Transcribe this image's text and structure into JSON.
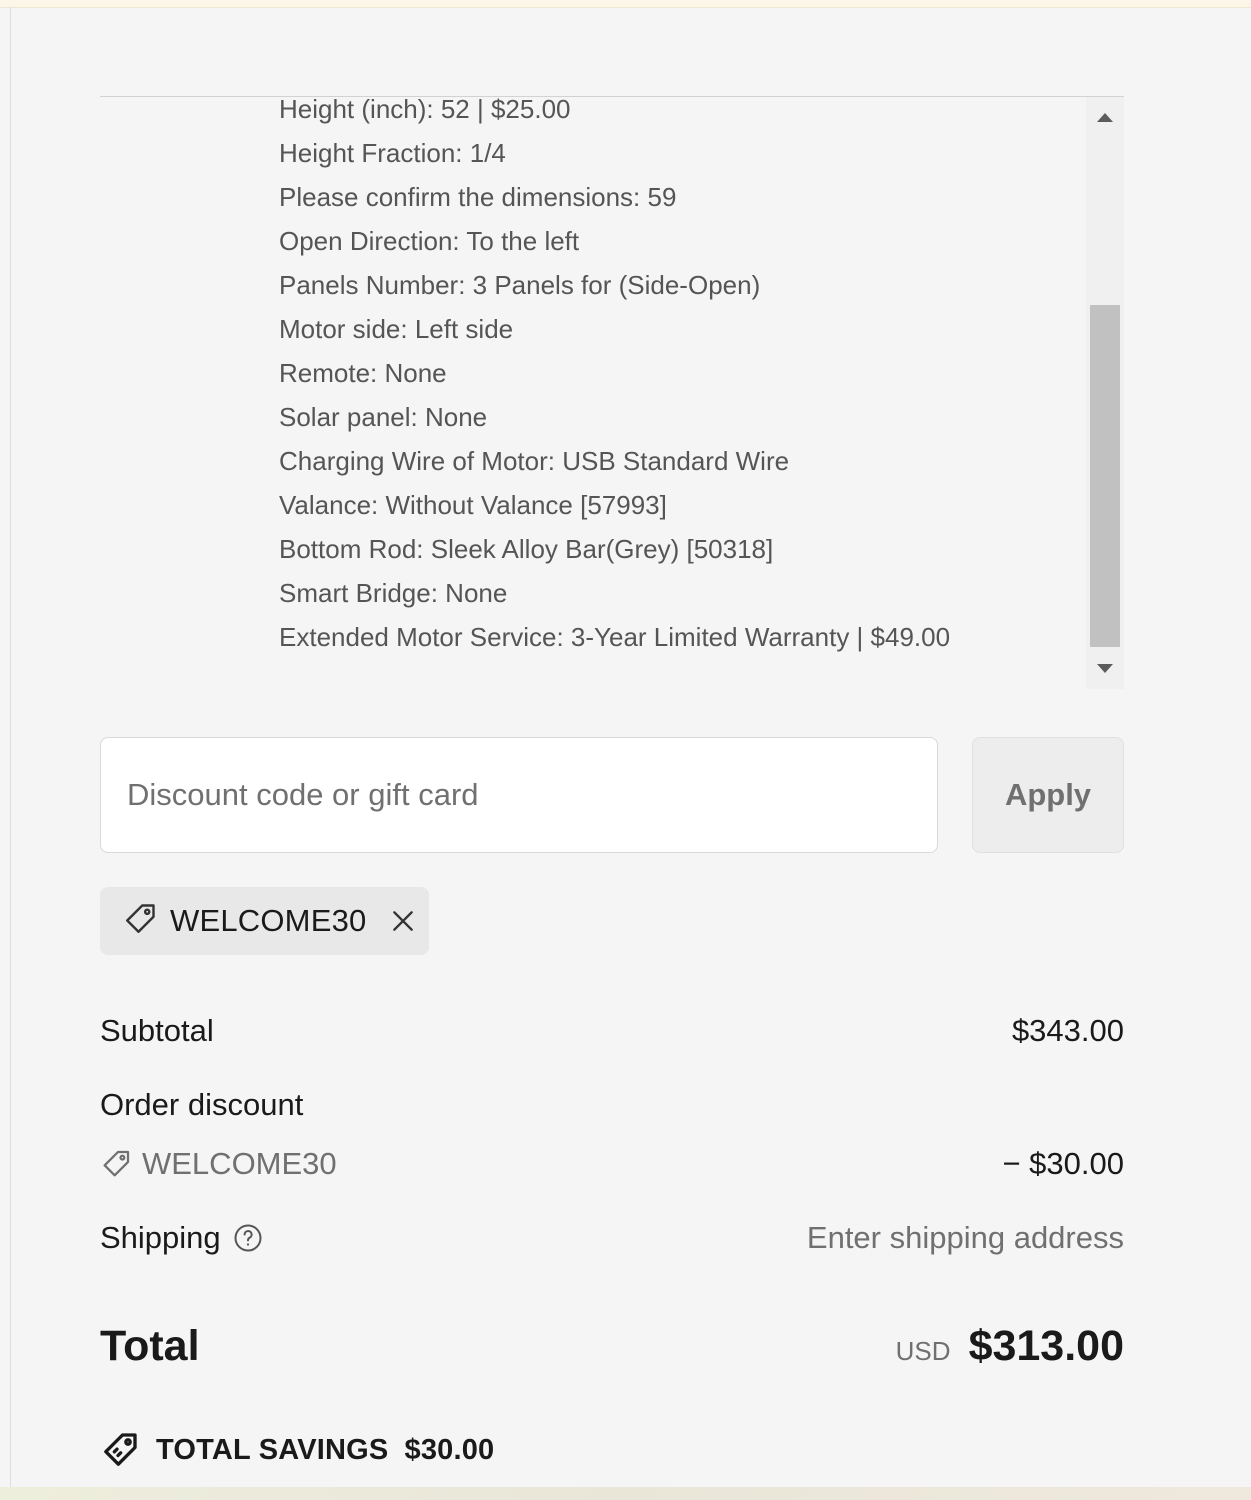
{
  "line_item_details": [
    "Height (inch): 52 | $25.00",
    "Height Fraction: 1/4",
    "Please confirm the dimensions: 59",
    "Open Direction: To the left",
    "Panels Number: 3 Panels for (Side-Open)",
    "Motor side: Left side",
    "Remote: None",
    "Solar panel: None",
    "Charging Wire of Motor: USB Standard Wire",
    "Valance: Without Valance [57993]",
    "Bottom Rod: Sleek Alloy Bar(Grey) [50318]",
    "Smart Bridge: None",
    "Extended Motor Service: 3-Year Limited Warranty | $49.00"
  ],
  "discount": {
    "placeholder": "Discount code or gift card",
    "value": "",
    "apply_label": "Apply",
    "applied_code": "WELCOME30"
  },
  "summary": {
    "subtotal_label": "Subtotal",
    "subtotal_value": "$343.00",
    "order_discount_label": "Order discount",
    "discount_code": "WELCOME30",
    "discount_value": "− $30.00",
    "shipping_label": "Shipping",
    "shipping_value": "Enter shipping address",
    "total_label": "Total",
    "currency": "USD",
    "total_value": "$313.00",
    "savings_label": "TOTAL SAVINGS",
    "savings_value": "$30.00"
  },
  "icons": {
    "tag": "tag-icon",
    "remove": "close-icon",
    "help": "question-circle-icon",
    "savings": "savings-tag-icon",
    "scroll_up": "scroll-up-arrow-icon",
    "scroll_down": "scroll-down-arrow-icon"
  },
  "scroll": {
    "visible_fraction": 0.58,
    "position_fraction": 0.35
  },
  "colors": {
    "background": "#f5f5f5",
    "text": "#1a1a1a",
    "muted": "#707070",
    "chip": "#e8e8e8"
  }
}
